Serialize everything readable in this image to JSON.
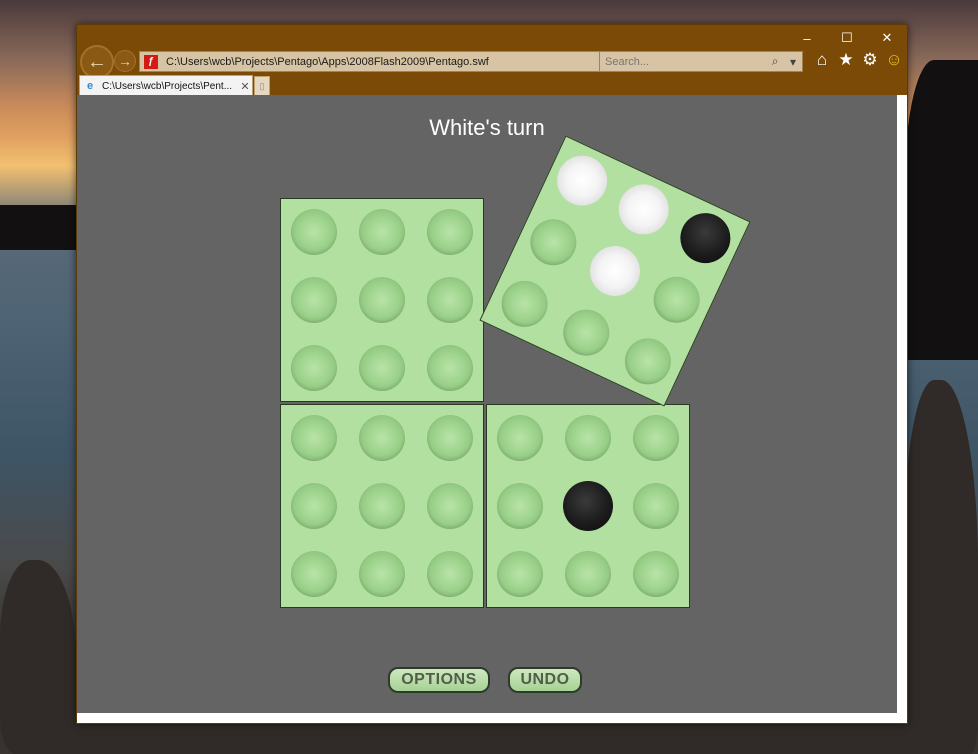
{
  "browser": {
    "address_url": "C:\\Users\\wcb\\Projects\\Pentago\\Apps\\2008Flash2009\\Pentago.swf",
    "search_placeholder": "Search...",
    "tab_title": "C:\\Users\\wcb\\Projects\\Pent...",
    "window_controls": [
      "–",
      "☐",
      "✕"
    ],
    "accent_color": "#7a4a06"
  },
  "game": {
    "status": "White's turn",
    "options_label": "OPTIONS",
    "undo_label": "UNDO",
    "board_color": "#b2e0a0",
    "background_color": "#646464",
    "quadrants": [
      {
        "name": "top-left",
        "rotated": false,
        "cells": [
          "empty",
          "empty",
          "empty",
          "empty",
          "empty",
          "empty",
          "empty",
          "empty",
          "empty"
        ]
      },
      {
        "name": "top-right",
        "rotated": true,
        "cells": [
          "white",
          "white",
          "black",
          "empty",
          "white",
          "empty",
          "empty",
          "empty",
          "empty"
        ]
      },
      {
        "name": "bottom-left",
        "rotated": false,
        "cells": [
          "empty",
          "empty",
          "empty",
          "empty",
          "empty",
          "empty",
          "empty",
          "empty",
          "empty"
        ]
      },
      {
        "name": "bottom-right",
        "rotated": false,
        "cells": [
          "empty",
          "empty",
          "empty",
          "empty",
          "black",
          "empty",
          "empty",
          "empty",
          "empty"
        ]
      }
    ]
  }
}
